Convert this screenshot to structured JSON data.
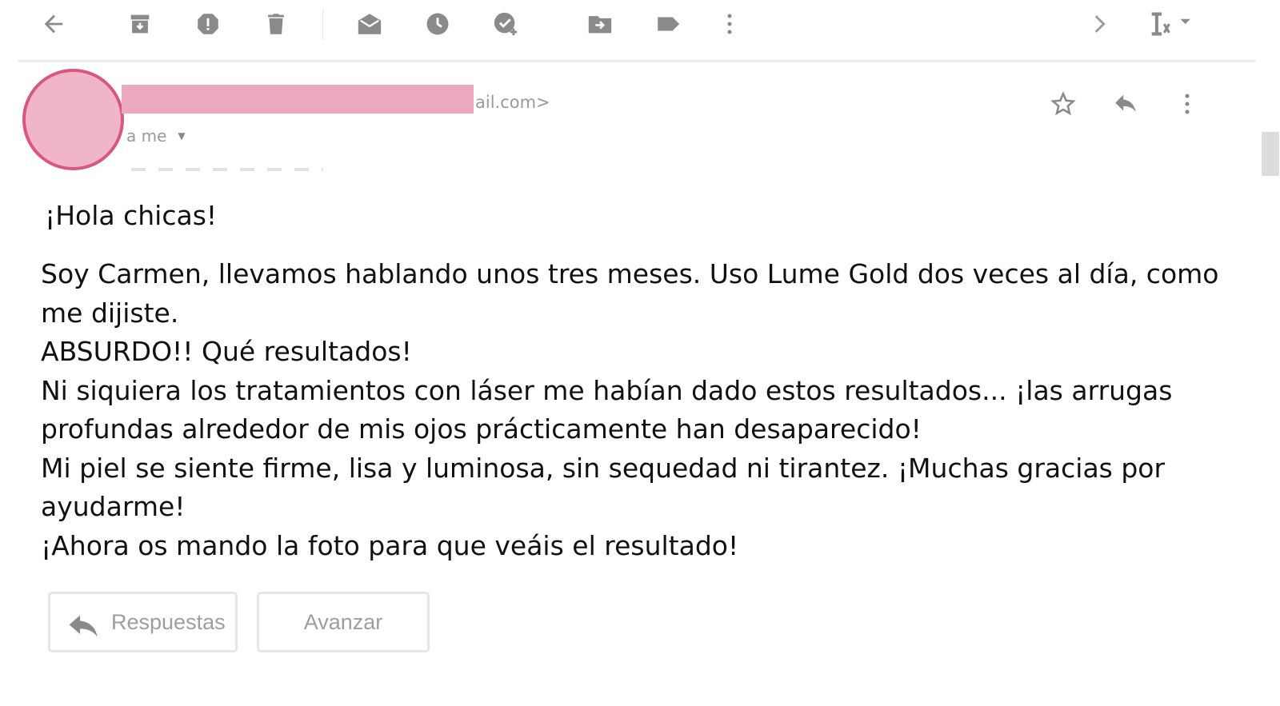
{
  "toolbar": {
    "icons": [
      "back-arrow-icon",
      "archive-icon",
      "report-spam-icon",
      "delete-icon",
      "mark-unread-icon",
      "snooze-icon",
      "add-to-tasks-icon",
      "move-to-icon",
      "label-icon",
      "more-vert-icon",
      "next-icon",
      "input-tools-icon"
    ],
    "icon_color": "#8a8a8a"
  },
  "sender": {
    "email_tail": "ail.com>",
    "to_label": "a me",
    "avatar_color": "#f0b6c7",
    "avatar_border": "#d9577e",
    "redaction_color": "#eaa9c1"
  },
  "header_actions": {
    "icons": [
      "star-icon",
      "reply-icon",
      "more-vert-icon"
    ]
  },
  "message": {
    "greeting": "¡Hola chicas!",
    "paragraphs": [
      "Soy Carmen, llevamos hablando unos tres meses. Uso Lume Gold dos veces al día, como me dijiste.",
      "ABSURDO!! Qué resultados!",
      "Ni siquiera los tratamientos con láser me habían dado estos resultados... ¡las arrugas profundas alrededor de mis ojos prácticamente han desaparecido!",
      "Mi piel se siente firme, lisa y luminosa, sin sequedad ni tirantez. ¡Muchas gracias por ayudarme!",
      "¡Ahora os mando la foto para que veáis el resultado!"
    ]
  },
  "actions": {
    "reply_label": "Respuestas",
    "forward_label": "Avanzar"
  }
}
